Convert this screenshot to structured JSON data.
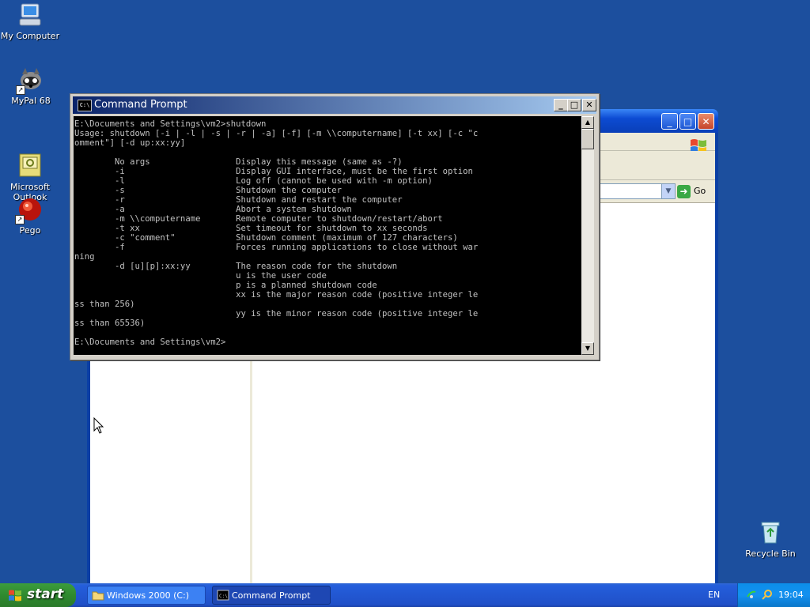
{
  "desktop": {
    "icons": [
      {
        "label": "My Computer",
        "icon": "my-computer-icon"
      },
      {
        "label": "MyPal 68",
        "icon": "mypal-icon"
      },
      {
        "label": "Microsoft\nOutlook",
        "icon": "outlook-icon"
      },
      {
        "label": "Pego",
        "icon": "pego-icon"
      },
      {
        "label": "Recycle Bin",
        "icon": "recycle-bin-icon"
      }
    ]
  },
  "explorer": {
    "go_label": "Go"
  },
  "cmd": {
    "title": "Command Prompt",
    "output": "E:\\Documents and Settings\\vm2>shutdown\nUsage: shutdown [-i | -l | -s | -r | -a] [-f] [-m \\\\computername] [-t xx] [-c \"c\nomment\"] [-d up:xx:yy]\n\n        No args                 Display this message (same as -?)\n        -i                      Display GUI interface, must be the first option\n        -l                      Log off (cannot be used with -m option)\n        -s                      Shutdown the computer\n        -r                      Shutdown and restart the computer\n        -a                      Abort a system shutdown\n        -m \\\\computername       Remote computer to shutdown/restart/abort\n        -t xx                   Set timeout for shutdown to xx seconds\n        -c \"comment\"            Shutdown comment (maximum of 127 characters)\n        -f                      Forces running applications to close without war\nning\n        -d [u][p]:xx:yy         The reason code for the shutdown\n                                u is the user code\n                                p is a planned shutdown code\n                                xx is the major reason code (positive integer le\nss than 256)\n                                yy is the minor reason code (positive integer le\nss than 65536)\n\nE:\\Documents and Settings\\vm2>"
  },
  "taskbar": {
    "start_label": "start",
    "buttons": [
      {
        "label": "Windows 2000 (C:)",
        "icon": "folder-icon",
        "active": false
      },
      {
        "label": "Command Prompt",
        "icon": "cmd-icon",
        "active": true
      }
    ],
    "language": "EN",
    "clock": "19:04"
  },
  "colors": {
    "desktop": "#1c4f9e",
    "taskbar": "#245edb",
    "start_button": "#2f8a2f",
    "cmd_title_start": "#0a246a",
    "cmd_title_end": "#a6caf0",
    "console_text": "#c0c0c0",
    "console_bg": "#000000"
  }
}
